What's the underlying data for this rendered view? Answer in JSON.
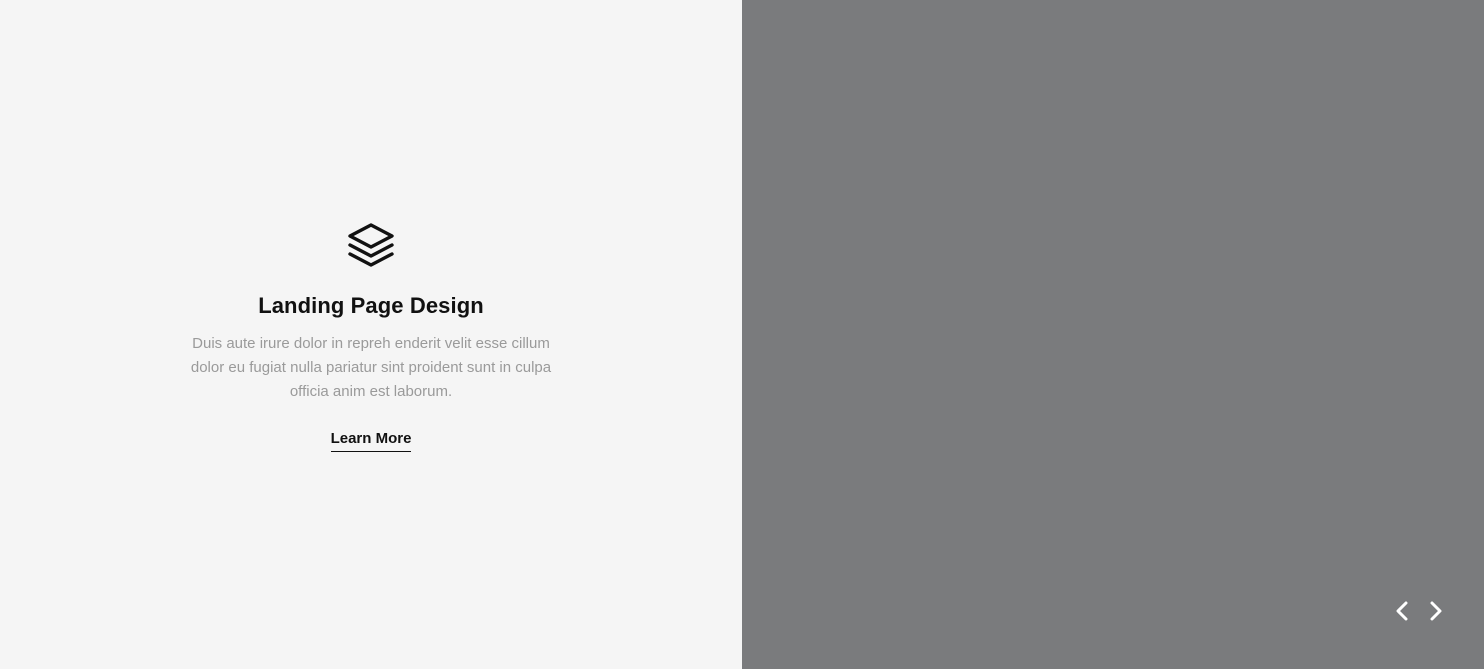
{
  "feature": {
    "icon": "layers-icon",
    "title": "Landing Page Design",
    "description": "Duis aute irure dolor in repreh enderit velit esse cillum dolor eu fugiat nulla pariatur sint proident sunt in culpa officia anim est laborum.",
    "cta_label": "Learn More"
  },
  "slider": {
    "prev_icon": "chevron-left-icon",
    "next_icon": "chevron-right-icon"
  },
  "colors": {
    "left_background": "#f5f5f5",
    "right_background": "#7a7b7d",
    "title": "#111111",
    "description": "#9a9a9a",
    "arrows": "#ffffff"
  }
}
